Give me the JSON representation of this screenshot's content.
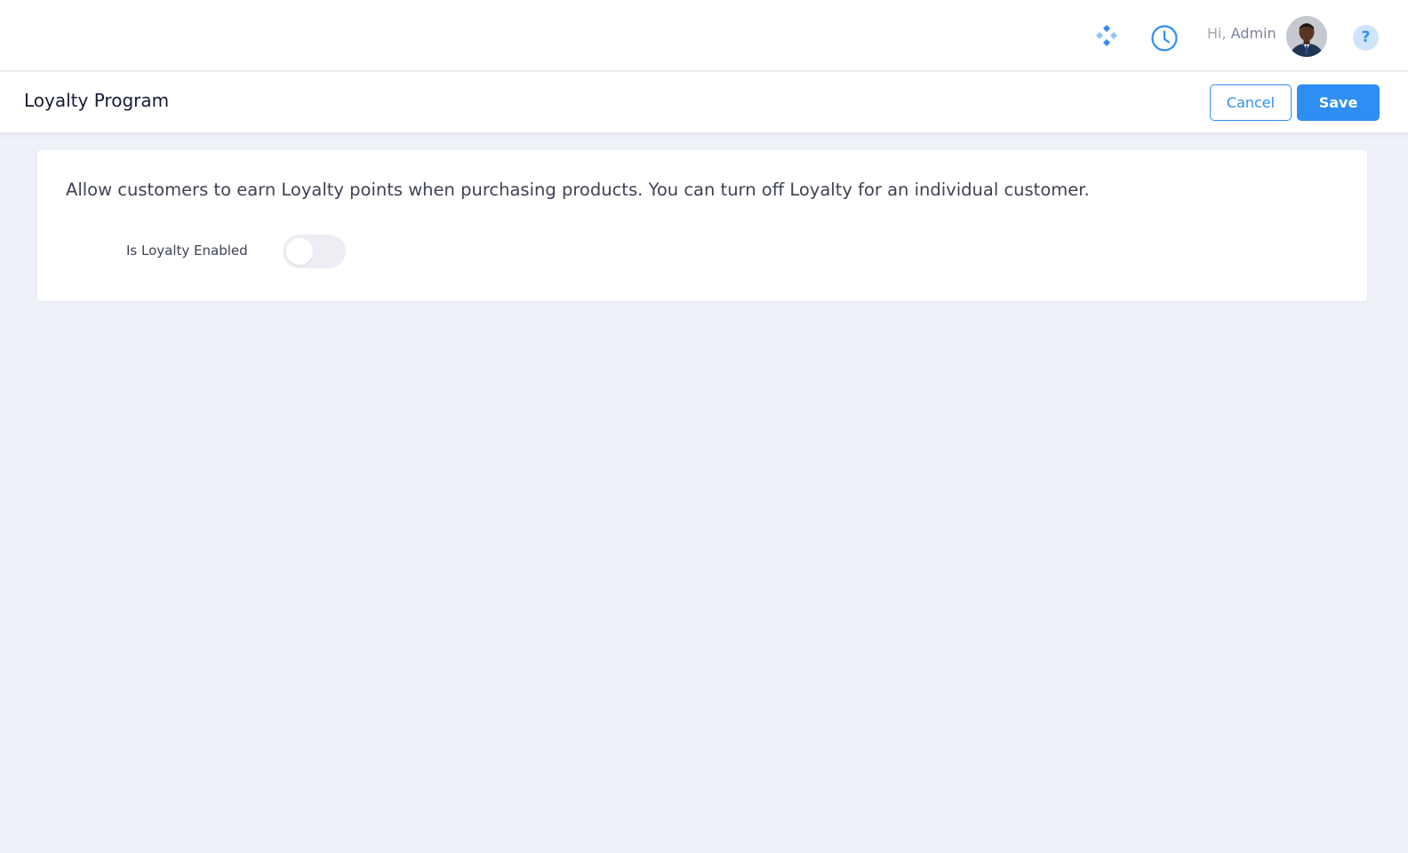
{
  "topbar": {
    "apps_icon": "apps-diamond-icon",
    "clock_icon": "clock-icon",
    "greeting_prefix": "Hi,",
    "user_name": "Admin",
    "avatar": "user-avatar",
    "help_icon_glyph": "?"
  },
  "header": {
    "title": "Loyalty Program",
    "cancel_label": "Cancel",
    "save_label": "Save"
  },
  "settings": {
    "description": "Allow customers to earn Loyalty points when purchasing products. You can turn off Loyalty for an individual customer.",
    "toggle_label": "Is Loyalty Enabled",
    "toggle_enabled": false
  },
  "colors": {
    "accent": "#2f8ef3",
    "page_background": "#eef1f8",
    "toggle_off": "#eceef3"
  }
}
